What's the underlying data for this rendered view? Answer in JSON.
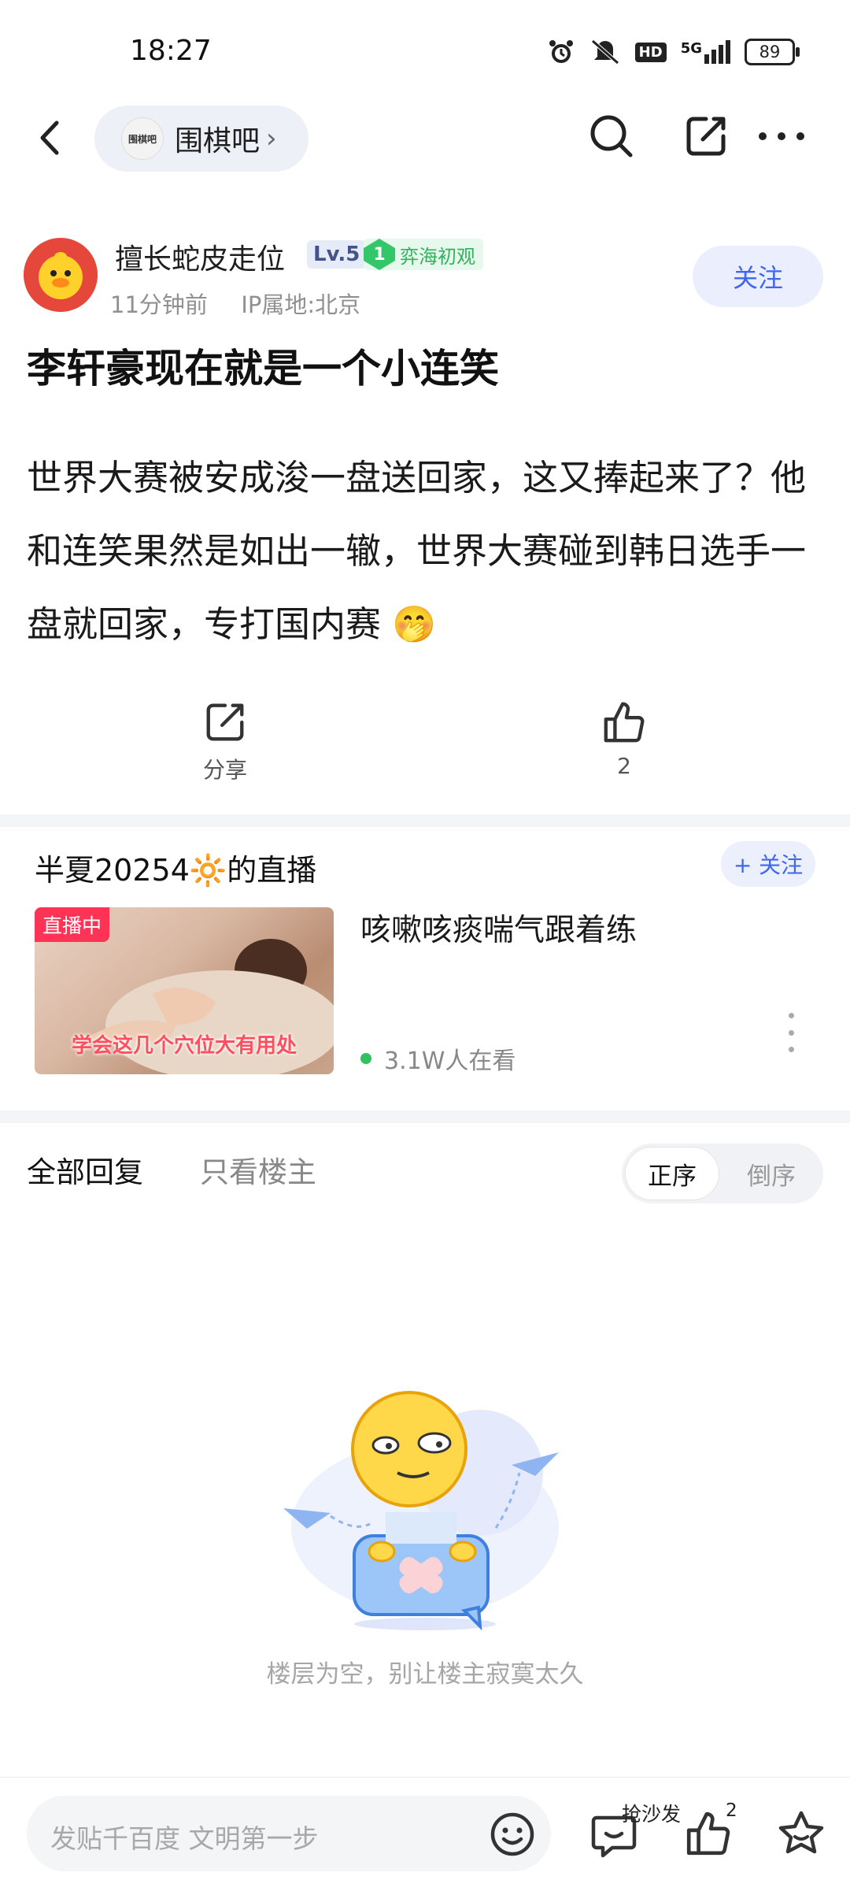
{
  "status_bar": {
    "time": "18:27",
    "signal_label": "5G",
    "hd_label": "HD",
    "battery": "89",
    "icons": [
      "alarm-icon",
      "mute-icon",
      "hd-icon",
      "signal-icon",
      "battery-icon"
    ]
  },
  "nav": {
    "forum_logo_text": "围棋吧",
    "forum_name": "围棋吧",
    "forum_chevron": "›",
    "icons": [
      "back-icon",
      "search-icon",
      "share-edit-icon",
      "more-icon"
    ]
  },
  "post": {
    "author": "擅长蛇皮走位",
    "level": "Lv.5",
    "honor_rank": "1",
    "honor_title": "弈海初观",
    "time_ago": "11分钟前",
    "ip_location": "IP属地:北京",
    "follow_label": "关注",
    "title": "李轩豪现在就是一个小连笑",
    "body": "世界大赛被安成浚一盘送回家，这又捧起来了？他和连笑果然是如出一辙，世界大赛碰到韩日选手一盘就回家，专打国内赛 🤭",
    "share_label": "分享",
    "like_count": "2"
  },
  "live": {
    "host_name": "半夏20254",
    "host_emoji": "🔆",
    "host_suffix": "的直播",
    "follow_label": "+ 关注",
    "tag": "直播中",
    "thumb_caption": "学会这几个穴位大有用处",
    "title": "咳嗽咳痰喘气跟着练",
    "viewers": "3.1W人在看"
  },
  "replies": {
    "tab_all": "全部回复",
    "tab_op": "只看楼主",
    "sort_asc": "正序",
    "sort_desc": "倒序",
    "empty_text": "楼层为空，别让楼主寂寞太久"
  },
  "bottom_bar": {
    "placeholder": "发贴千百度 文明第一步",
    "sofa_label": "抢沙发",
    "like_count": "2"
  },
  "colors": {
    "accent_blue": "#3e66f0",
    "live_red": "#ff3356",
    "honor_green": "#34c76a",
    "avatar_red": "#e74a3b"
  }
}
